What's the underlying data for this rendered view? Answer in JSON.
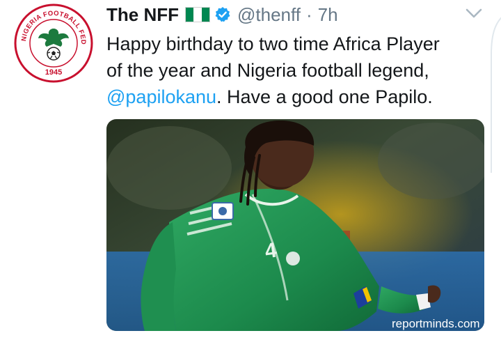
{
  "account": {
    "display_name": "The NFF",
    "handle": "@thenff",
    "separator": "·",
    "time": "7h",
    "verified": true,
    "flag_icon": "nigeria-flag-icon",
    "avatar": {
      "ring_text": "NIGERIA FOOTBALL FEDERATION",
      "year": "1945",
      "color": "#c8102e"
    }
  },
  "tweet": {
    "line1": "Happy birthday to two time Africa Player",
    "line2": "of the year and Nigeria football legend,",
    "mention": "@papilokanu",
    "line3_rest": ". Have a good one Papilo."
  },
  "media": {
    "jersey_number": "4",
    "watermark": "reportminds.com"
  },
  "icons": {
    "options": "chevron-down-icon",
    "verified": "verified-badge-icon"
  },
  "colors": {
    "accent": "#1da1f2",
    "muted": "#657786",
    "jersey": "#1c8a4c",
    "nigeria_green": "#008751"
  }
}
